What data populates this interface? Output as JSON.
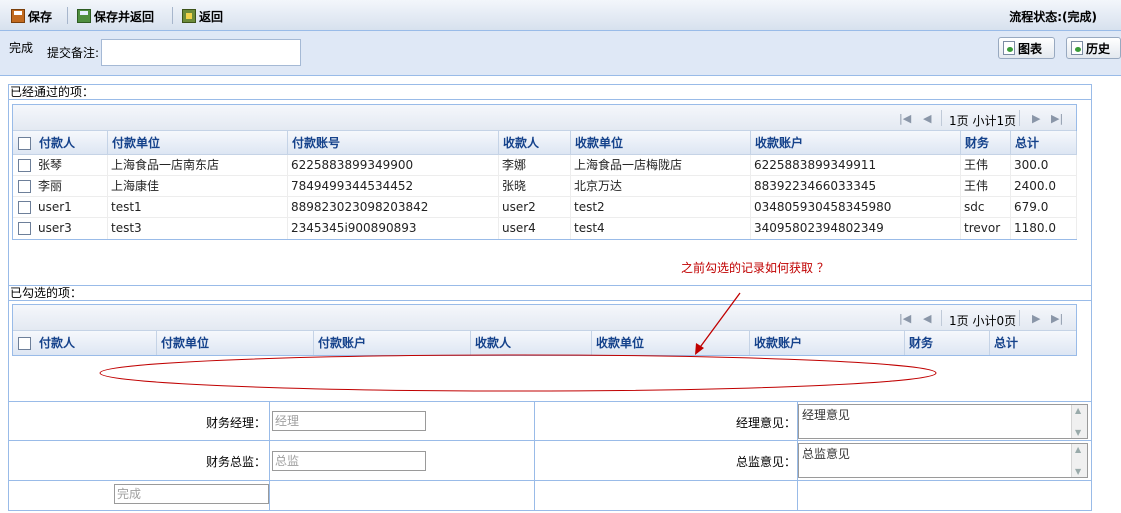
{
  "toolbar": {
    "save_label": "保存",
    "save_back_label": "保存并返回",
    "back_label": "返回",
    "status": "流程状态:(完成)"
  },
  "remark_bar": {
    "state_text": "完成",
    "remark_label": "提交备注:",
    "remark_value": "",
    "chart_button": "图表",
    "history_button": "历史"
  },
  "passed_section": {
    "title": "已经通过的项：",
    "pager_text": "1页 小计1页",
    "columns": [
      "付款人",
      "付款单位",
      "付款账号",
      "收款人",
      "收款单位",
      "收款账户",
      "财务",
      "总计"
    ],
    "rows": [
      [
        "张琴",
        "上海食品一店南东店",
        "6225883899349900",
        "李娜",
        "上海食品一店梅陇店",
        "6225883899349911",
        "王伟",
        "300.0"
      ],
      [
        "李丽",
        "上海康佳",
        "7849499344534452",
        "张晓",
        "北京万达",
        "8839223466033345",
        "王伟",
        "2400.0"
      ],
      [
        "user1",
        "test1",
        "889823023098203842",
        "user2",
        "test2",
        "034805930458345980",
        "sdc",
        "679.0"
      ],
      [
        "user3",
        "test3",
        "2345345i900890893",
        "user4",
        "test4",
        "34095802394802349",
        "trevor",
        "1180.0"
      ]
    ]
  },
  "annotation": {
    "text": "之前勾选的记录如何获取 ？",
    "color": "#c00000"
  },
  "selected_section": {
    "title": "已勾选的项：",
    "pager_text": "1页 小计0页",
    "columns": [
      "付款人",
      "付款单位",
      "付款账户",
      "收款人",
      "收款单位",
      "收款账户",
      "财务",
      "总计"
    ]
  },
  "form": {
    "manager_label": "财务经理：",
    "manager_placeholder": "经理",
    "manager_opinion_label": "经理意见：",
    "manager_opinion_value": "经理意见",
    "director_label": "财务总监：",
    "director_placeholder": "总监",
    "director_opinion_label": "总监意见：",
    "director_opinion_value": "总监意见",
    "done_placeholder": "完成"
  },
  "colors": {
    "border": "#99bbe8",
    "header_text": "#15428b",
    "annotation": "#c00000"
  }
}
